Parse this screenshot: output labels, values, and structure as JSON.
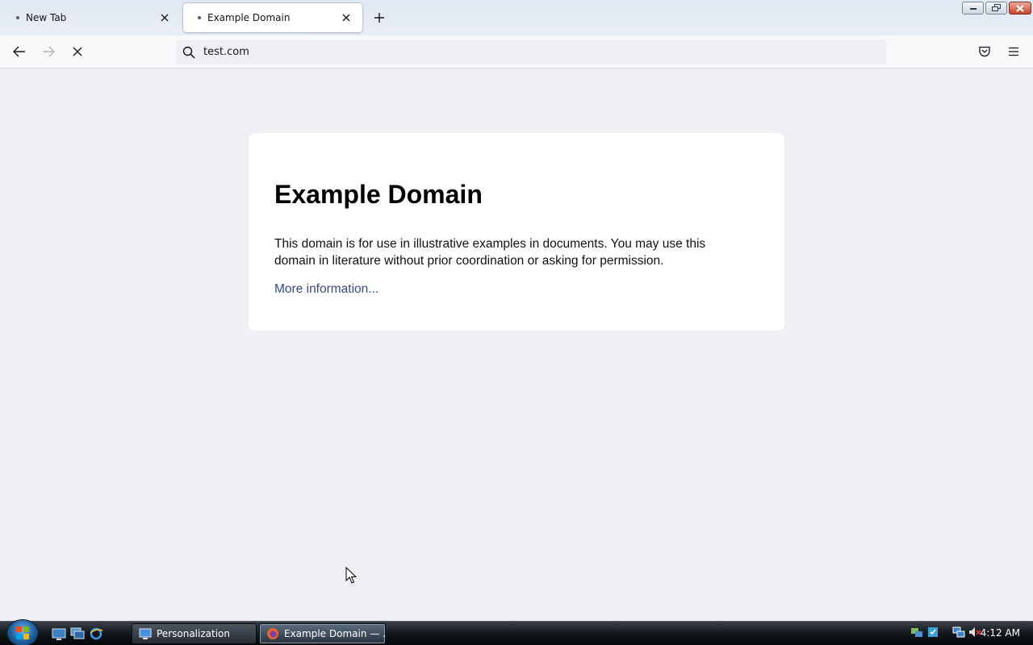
{
  "tabs": [
    {
      "title": "New Tab",
      "active": false
    },
    {
      "title": "Example Domain",
      "active": true
    }
  ],
  "urlbar": {
    "url": "test.com"
  },
  "page": {
    "heading": "Example Domain",
    "paragraph": "This domain is for use in illustrative examples in documents. You may use this domain in literature without prior coordination or asking for permission.",
    "link": "More information..."
  },
  "taskbar": {
    "buttons": [
      {
        "label": "Personalization",
        "icon": "personalization-icon"
      },
      {
        "label": "Example Domain — ...",
        "icon": "firefox-icon"
      }
    ],
    "clock": "4:12 AM"
  },
  "colors": {
    "page_bg": "#f0f0f4",
    "card_bg": "#ffffff",
    "link": "#38488f",
    "taskbar": "#14181c"
  }
}
